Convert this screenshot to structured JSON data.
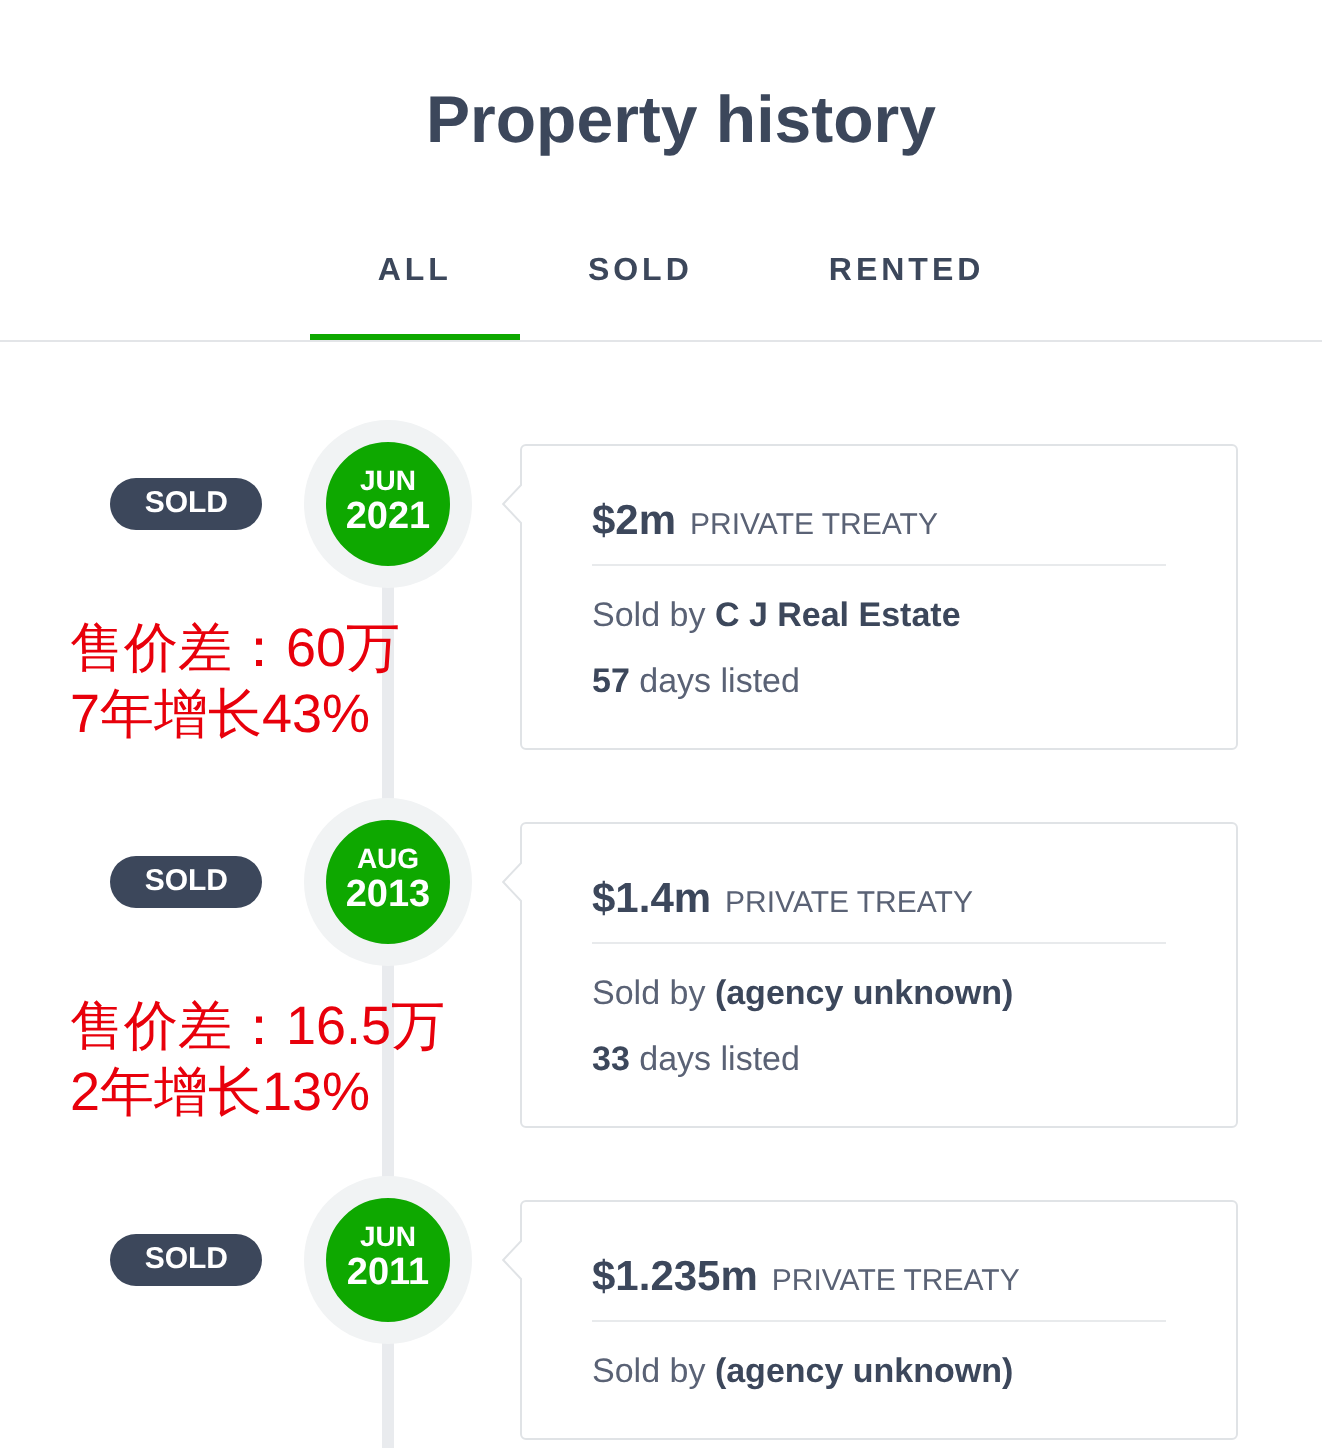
{
  "title": "Property history",
  "tabs": [
    {
      "label": "ALL",
      "selected": true
    },
    {
      "label": "SOLD",
      "selected": false
    },
    {
      "label": "RENTED",
      "selected": false
    }
  ],
  "history": [
    {
      "status": "SOLD",
      "month": "JUN",
      "year": "2021",
      "price": "$2m",
      "sale_method": "PRIVATE TREATY",
      "sold_by": "Sold by **C J Real Estate**",
      "listing": "**57** days listed",
      "annotation": [
        "售价差：60万",
        "7年增长43%"
      ]
    },
    {
      "status": "SOLD",
      "month": "AUG",
      "year": "2013",
      "price": "$1.4m",
      "sale_method": "PRIVATE TREATY",
      "sold_by": "Sold by **(agency unknown)**",
      "listing": "**33** days listed",
      "annotation": [
        "售价差：16.5万",
        "2年增长13%"
      ]
    },
    {
      "status": "SOLD",
      "month": "JUN",
      "year": "2011",
      "price": "$1.235m",
      "sale_method": "PRIVATE TREATY",
      "sold_by": "Sold by **(agency unknown)**"
    }
  ]
}
